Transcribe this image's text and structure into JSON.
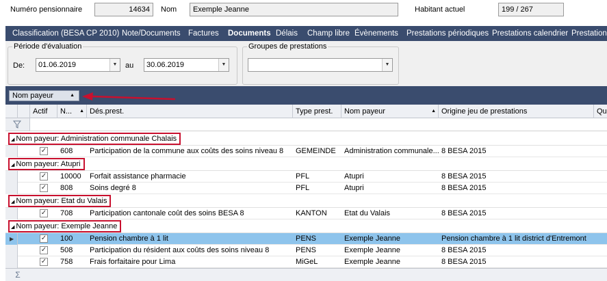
{
  "header": {
    "num_label": "Numéro pensionnaire",
    "num_value": "14634",
    "nom_label": "Nom",
    "nom_value": "Exemple Jeanne",
    "hab_label": "Habitant actuel",
    "hab_value": "199 / 267"
  },
  "tabs": [
    "Classification (BESA CP 2010)",
    "Note/Documents",
    "Factures",
    "Documents",
    "Délais",
    "Champ libre",
    "Évènements",
    "Prestations périodiques",
    "Prestations calendrier",
    "Prestations"
  ],
  "active_tab": "Documents",
  "periode": {
    "label": "Période d'évaluation",
    "de_label": "De:",
    "de_value": "01.06.2019",
    "au_label": "au",
    "au_value": "30.06.2019"
  },
  "groupes": {
    "label": "Groupes de prestations",
    "value": ""
  },
  "group_chip": "Nom payeur",
  "columns": [
    "Actif",
    "N...",
    "Dés.prest.",
    "Type prest.",
    "Nom payeur",
    "Origine jeu de prestations",
    "Qu"
  ],
  "groups": [
    {
      "label": "Nom payeur:  Administration communale Chalais",
      "rows": [
        {
          "actif": "✓",
          "num": "608",
          "des": "Participation de la commune aux coûts des soins niveau 8",
          "type": "GEMEINDE",
          "payeur": "Administration communale...",
          "origine": "8 BESA 2015",
          "selected": false
        }
      ]
    },
    {
      "label": "Nom payeur:  Atupri",
      "rows": [
        {
          "actif": "✓",
          "num": "10000",
          "des": "Forfait assistance pharmacie",
          "type": "PFL",
          "payeur": "Atupri",
          "origine": "8 BESA 2015",
          "selected": false
        },
        {
          "actif": "✓",
          "num": "808",
          "des": "Soins degré 8",
          "type": "PFL",
          "payeur": "Atupri",
          "origine": "8 BESA 2015",
          "selected": false
        }
      ]
    },
    {
      "label": "Nom payeur:  Etat du Valais",
      "rows": [
        {
          "actif": "✓",
          "num": "708",
          "des": "Participation cantonale coût des soins BESA 8",
          "type": "KANTON",
          "payeur": "Etat du Valais",
          "origine": "8 BESA 2015",
          "selected": false
        }
      ]
    },
    {
      "label": "Nom payeur:  Exemple Jeanne",
      "rows": [
        {
          "actif": "✓",
          "num": "100",
          "des": "Pension chambre à 1 lit",
          "type": "PENS",
          "payeur": "Exemple Jeanne",
          "origine": "Pension chambre à 1 lit district d'Entremont",
          "selected": true
        },
        {
          "actif": "✓",
          "num": "508",
          "des": "Participation du résident aux coûts des soins niveau 8",
          "type": "PENS",
          "payeur": "Exemple Jeanne",
          "origine": "8 BESA 2015",
          "selected": false
        },
        {
          "actif": "✓",
          "num": "758",
          "des": "Frais forfaitaire pour Lima",
          "type": "MiGeL",
          "payeur": "Exemple Jeanne",
          "origine": "8 BESA 2015",
          "selected": false
        }
      ]
    }
  ],
  "icons": {
    "filter": "filter-icon",
    "sum": "sum-icon",
    "arrow": "red-arrow-annotation"
  },
  "colors": {
    "tabbar": "#3a4c6e",
    "selected_row": "#8ec4ec",
    "annotation": "#c8102e"
  }
}
